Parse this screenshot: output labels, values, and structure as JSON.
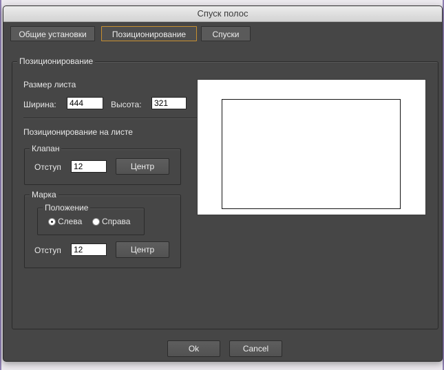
{
  "window": {
    "title": "Спуск полос"
  },
  "tabs": [
    {
      "label": "Общие установки",
      "active": false
    },
    {
      "label": "Позиционирование",
      "active": true
    },
    {
      "label": "Спуски",
      "active": false
    }
  ],
  "positioning": {
    "group_title": "Позиционирование",
    "sheet_size": {
      "heading": "Размер листа",
      "width_label": "Ширина:",
      "width_value": "444",
      "height_label": "Высота:",
      "height_value": "321"
    },
    "on_sheet_heading": "Позиционирование на листе",
    "flap": {
      "title": "Клапан",
      "offset_label": "Отступ",
      "offset_value": "12",
      "center_label": "Центр"
    },
    "mark": {
      "title": "Марка",
      "position": {
        "title": "Положение",
        "options": [
          "Слева",
          "Справа"
        ],
        "selected": "Слева"
      },
      "offset_label": "Отступ",
      "offset_value": "12",
      "center_label": "Центр"
    }
  },
  "footer": {
    "ok_label": "Ok",
    "cancel_label": "Cancel"
  },
  "colors": {
    "dialog_bg": "#464646",
    "active_tab_border": "#c89030",
    "window_edge": "#8f7fb2"
  }
}
